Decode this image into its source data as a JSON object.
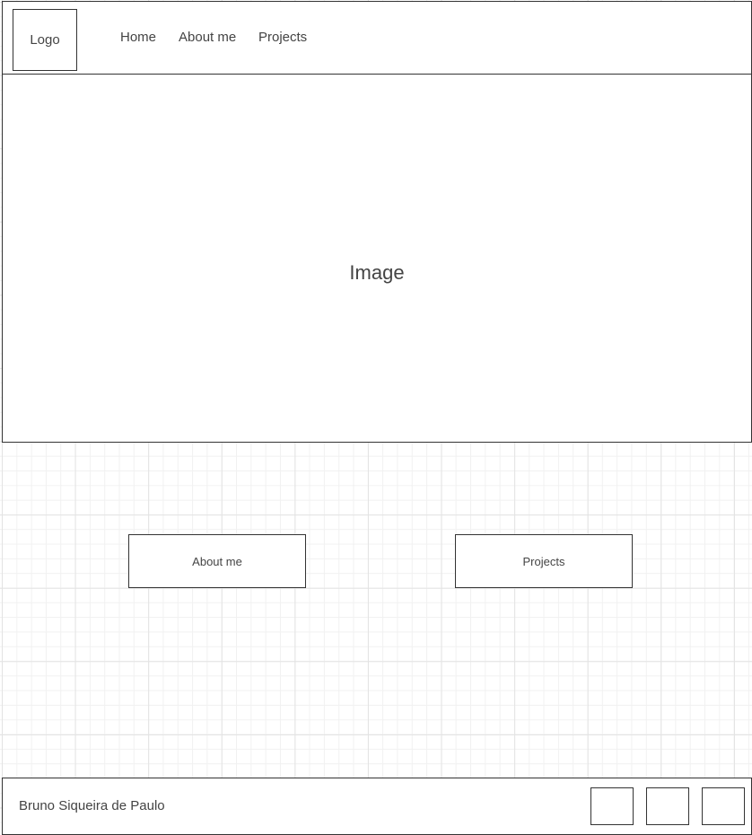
{
  "header": {
    "logo_label": "Logo",
    "nav": {
      "home": "Home",
      "about": "About me",
      "projects": "Projects"
    }
  },
  "hero": {
    "placeholder_label": "Image"
  },
  "actions": {
    "about_label": "About me",
    "projects_label": "Projects"
  },
  "footer": {
    "author_name": "Bruno Siqueira de Paulo",
    "social_buttons": [
      "social-placeholder",
      "social-placeholder",
      "social-placeholder"
    ]
  },
  "colors": {
    "border": "#333333",
    "text": "#444444",
    "background": "#ffffff",
    "grid_major": "#e3e3e3",
    "grid_minor": "#f1f1f1"
  }
}
